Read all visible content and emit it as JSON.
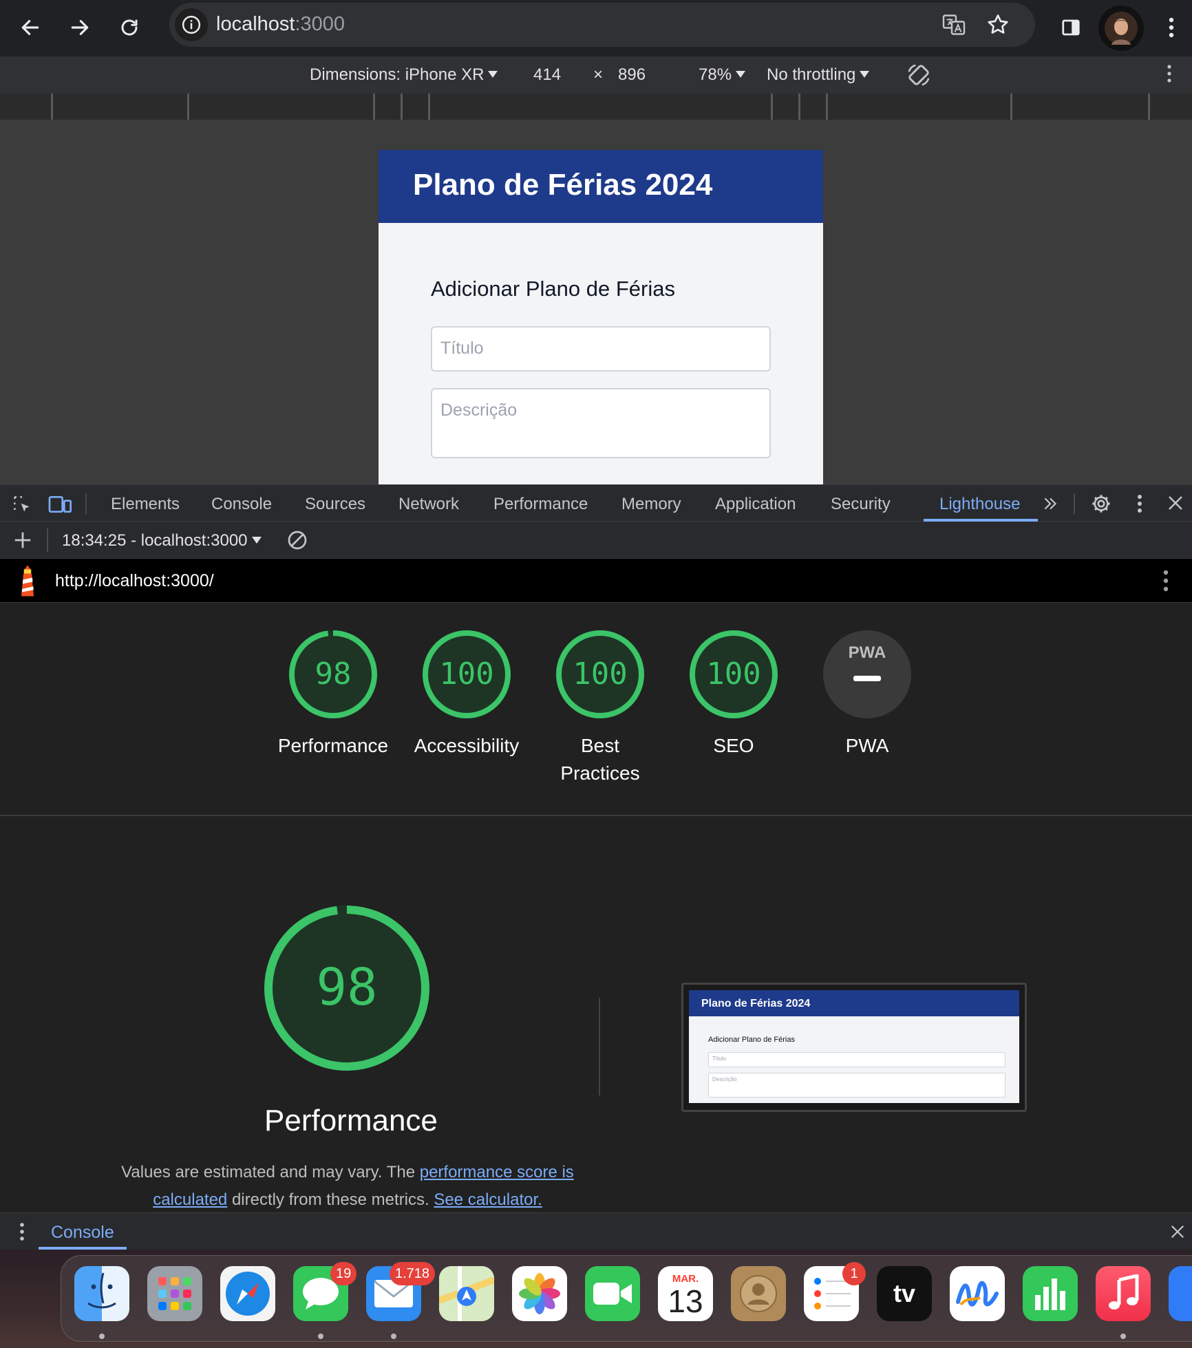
{
  "browser": {
    "url_host": "localhost",
    "url_port": ":3000",
    "icons": [
      "back-arrow-icon",
      "forward-arrow-icon",
      "reload-icon",
      "site-info-icon",
      "translate-icon",
      "bookmark-star-icon",
      "side-panel-icon",
      "profile-avatar",
      "kebab-menu-icon"
    ]
  },
  "device_toolbar": {
    "dimensions_label": "Dimensions: iPhone XR",
    "width": "414",
    "times": "×",
    "height": "896",
    "zoom": "78%",
    "throttling": "No throttling"
  },
  "emulated_page": {
    "title": "Plano de Férias 2024",
    "form_heading": "Adicionar Plano de Férias",
    "title_placeholder": "Título",
    "description_placeholder": "Descrição"
  },
  "devtools": {
    "tabs": [
      "Elements",
      "Console",
      "Sources",
      "Network",
      "Performance",
      "Memory",
      "Application",
      "Security",
      "Lighthouse"
    ],
    "active_tab": "Lighthouse",
    "report_selector": "18:34:25 - localhost:3000",
    "report_url": "http://localhost:3000/"
  },
  "lighthouse": {
    "scores": [
      {
        "label": "Performance",
        "value": "98",
        "score": 98
      },
      {
        "label": "Accessibility",
        "value": "100",
        "score": 100
      },
      {
        "label": "Best Practices",
        "value": "100",
        "score": 100
      },
      {
        "label": "SEO",
        "value": "100",
        "score": 100
      },
      {
        "label": "PWA",
        "value": "",
        "score": null
      }
    ],
    "pwa_badge": "PWA",
    "main_score": {
      "value": "98",
      "score": 98,
      "label": "Performance"
    },
    "note_prefix": "Values are estimated and may vary. The ",
    "note_link1": "performance score is calculated",
    "note_middle": " directly from these metrics. ",
    "note_link2": "See calculator.",
    "colors": {
      "pass": "#3bc468",
      "pass_bg": "#1e3525",
      "link": "#7cacf8"
    }
  },
  "console_drawer": {
    "tab_label": "Console"
  },
  "dock": {
    "apps": [
      {
        "name": "Finder",
        "badge": ""
      },
      {
        "name": "Launchpad",
        "badge": ""
      },
      {
        "name": "Safari",
        "badge": ""
      },
      {
        "name": "Messages",
        "badge": "19"
      },
      {
        "name": "Mail",
        "badge": "1.718"
      },
      {
        "name": "Maps",
        "badge": ""
      },
      {
        "name": "Photos",
        "badge": ""
      },
      {
        "name": "FaceTime",
        "badge": ""
      },
      {
        "name": "Calendar",
        "badge": "",
        "month": "MAR.",
        "day": "13"
      },
      {
        "name": "Contacts",
        "badge": ""
      },
      {
        "name": "Reminders",
        "badge": "1"
      },
      {
        "name": "TV",
        "badge": "",
        "text": "tv"
      },
      {
        "name": "Freeform",
        "badge": ""
      },
      {
        "name": "Numbers",
        "badge": ""
      },
      {
        "name": "Music",
        "badge": ""
      }
    ]
  }
}
